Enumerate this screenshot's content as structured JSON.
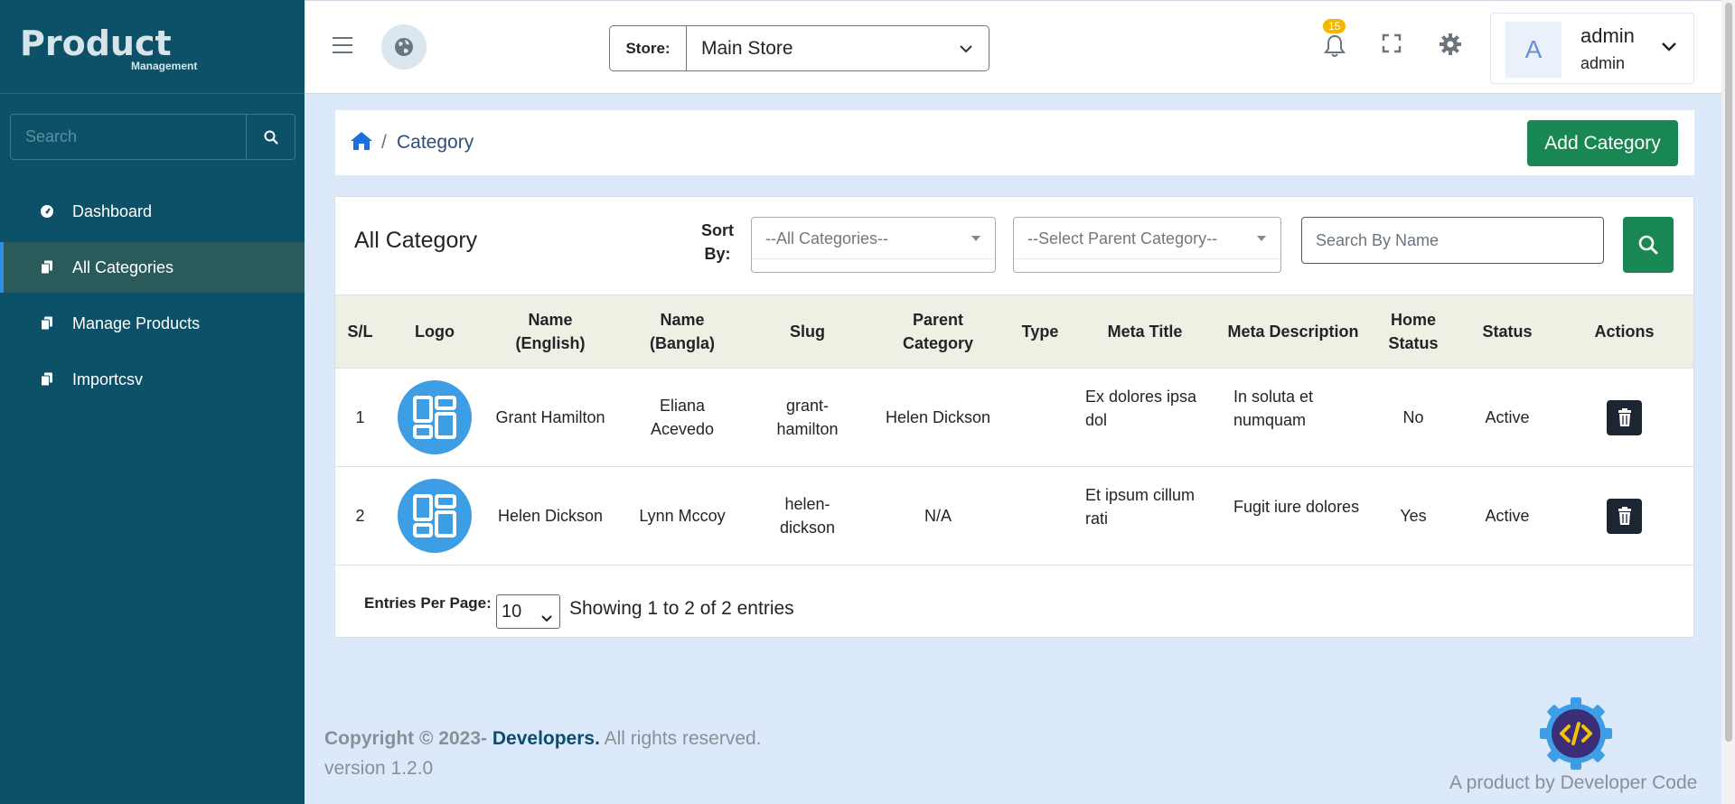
{
  "sidebar": {
    "logo_big": "Product",
    "logo_small": "Management",
    "search_placeholder": "Search",
    "items": [
      {
        "label": "Dashboard",
        "icon": "gauge-icon"
      },
      {
        "label": "All Categories",
        "icon": "copy-icon",
        "active": true
      },
      {
        "label": "Manage Products",
        "icon": "copy-icon"
      },
      {
        "label": "Importcsv",
        "icon": "copy-icon"
      }
    ]
  },
  "topbar": {
    "store_label": "Store:",
    "store_value": "Main Store",
    "notification_count": "15",
    "user_avatar": "A",
    "user_name": "admin",
    "user_role": "admin"
  },
  "breadcrumb": {
    "current": "Category",
    "separator": "/",
    "add_button": "Add Category"
  },
  "filters": {
    "title": "All Category",
    "sort_label_1": "Sort",
    "sort_label_2": "By:",
    "category_placeholder": "--All Categories--",
    "parent_placeholder": "--Select Parent Category--",
    "search_placeholder": "Search By Name"
  },
  "table": {
    "headers": {
      "sl": "S/L",
      "logo": "Logo",
      "name_en_1": "Name",
      "name_en_2": "(English)",
      "name_bn_1": "Name",
      "name_bn_2": "(Bangla)",
      "slug": "Slug",
      "parent_1": "Parent",
      "parent_2": "Category",
      "type": "Type",
      "meta_title": "Meta Title",
      "meta_desc": "Meta Description",
      "home_1": "Home",
      "home_2": "Status",
      "status": "Status",
      "actions": "Actions"
    },
    "rows": [
      {
        "sl": "1",
        "name_en": "Grant Hamilton",
        "name_bn_1": "Eliana",
        "name_bn_2": "Acevedo",
        "slug_1": "grant-",
        "slug_2": "hamilton",
        "parent": "Helen Dickson",
        "type": "",
        "meta_title_1": "Ex dolores ipsa",
        "meta_title_2": "dol",
        "meta_desc_1": "In soluta et",
        "meta_desc_2": "numquam",
        "home_status": "No",
        "status": "Active"
      },
      {
        "sl": "2",
        "name_en": "Helen Dickson",
        "name_bn_1": "Lynn Mccoy",
        "name_bn_2": "",
        "slug_1": "helen-",
        "slug_2": "dickson",
        "parent": "N/A",
        "type": "",
        "meta_title_1": "Et ipsum cillum",
        "meta_title_2": "rati",
        "meta_desc_1": "Fugit iure dolores",
        "meta_desc_2": "",
        "home_status": "Yes",
        "status": "Active"
      }
    ]
  },
  "pagination": {
    "entries_label": "Entries Per Page:",
    "entries_value": "10",
    "showing": "Showing 1 to 2 of 2 entries"
  },
  "footer": {
    "copyright_prefix": "Copyright © 2023-",
    "developer": "Developers.",
    "rights": "All rights reserved.",
    "version": "version 1.2.0",
    "product_by": "A product by Developer Code"
  },
  "colors": {
    "sidebar_bg": "#0c5168",
    "primary_green": "#198754",
    "page_bg": "#dce9fb"
  }
}
